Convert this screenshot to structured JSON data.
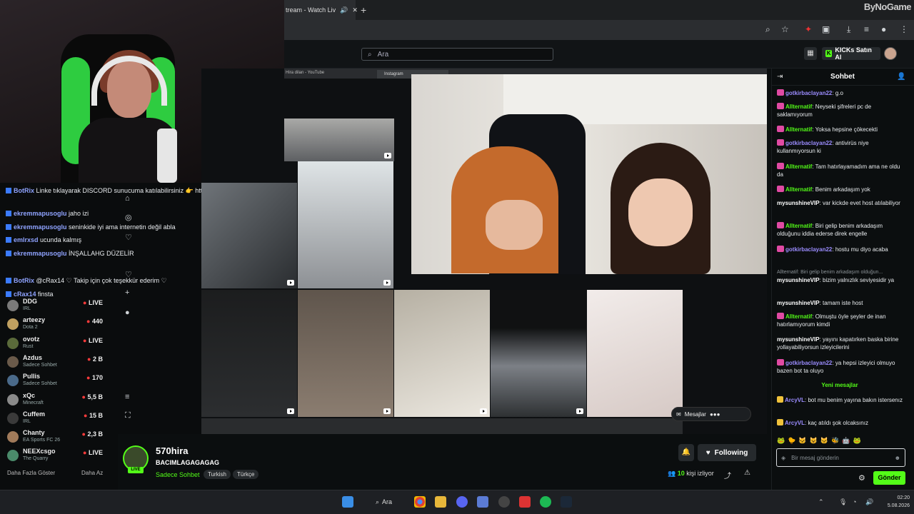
{
  "browser": {
    "tab_title": "tream - Watch Liv",
    "brand": "ByNoGame"
  },
  "site": {
    "search_placeholder": "Ara",
    "kick_button": "KICKs Satın Al"
  },
  "instagram_tabs": {
    "tab1": "Hira dilan - YouTube",
    "tab2": "Instagram"
  },
  "overlay_chat": [
    {
      "user": "BotRix",
      "text": "Linke tıklayarak DISCORD sunucuma katılabilirsiniz 👉 https://discord.gg/HGskgtJUtU"
    },
    {
      "user": "ekremmapusoglu",
      "text": "jaho izi"
    },
    {
      "user": "ekremmapusoglu",
      "text": "seninkide iyi ama internetin değil abla"
    },
    {
      "user": "emlrxsd",
      "text": "ucunda kalmış"
    },
    {
      "user": "ekremmapusoglu",
      "text": "İNŞALLAHG DÜZELİR"
    },
    {
      "user": "BotRix",
      "text": "@cRax14 ♡ Takip için çok teşekkür ederim ♡"
    },
    {
      "user": "cRax14",
      "text": "finsta"
    }
  ],
  "sidebar": {
    "items": [
      {
        "name": "DDG",
        "category": "IRL",
        "viewers": "LIVE"
      },
      {
        "name": "arteezy",
        "category": "Dota 2",
        "viewers": "440"
      },
      {
        "name": "ovotz",
        "category": "Rust",
        "viewers": "LIVE"
      },
      {
        "name": "Azdus",
        "category": "Sadece Sohbet",
        "viewers": "2 B"
      },
      {
        "name": "Pullis",
        "category": "Sadece Sohbet",
        "viewers": "170"
      },
      {
        "name": "xQc",
        "category": "Minecraft",
        "viewers": "5,5 B"
      },
      {
        "name": "Cuffem",
        "category": "IRL",
        "viewers": "15 B"
      },
      {
        "name": "Chanty",
        "category": "EA Sports FC 26",
        "viewers": "2,3 B"
      },
      {
        "name": "NEEXcsgo",
        "category": "The Quarry",
        "viewers": "LIVE"
      }
    ],
    "show_more": "Daha Fazla Göster",
    "show_less": "Daha Az"
  },
  "video": {
    "messages_label": "Mesajlar"
  },
  "stream": {
    "channel": "570hira",
    "title": "BACIMLAGAGAGAG",
    "category": "Sadece Sohbet",
    "tags": [
      "Turkish",
      "Türkçe"
    ],
    "live": "LIVE",
    "viewers_count": "10",
    "viewers_label": "kişi izliyor",
    "follow_label": "Following"
  },
  "chat": {
    "title": "Sohbet",
    "messages": [
      {
        "user": "gotkirbaclayan22",
        "color": "#9b8cff",
        "text": "g.o",
        "badge": "sub"
      },
      {
        "user": "Allternatif",
        "color": "#53fc18",
        "text": "Neyseki şifreleri pc de saklamıyorum",
        "badge": "sub"
      },
      {
        "user": "Allternatif",
        "color": "#53fc18",
        "text": "Yoksa hepsine çökecekti",
        "badge": "sub"
      },
      {
        "user": "gotkirbaclayan22",
        "color": "#9b8cff",
        "text": "antivirüs niye kullanmıyorsun ki",
        "badge": "sub"
      },
      {
        "user": "Allternatif",
        "color": "#53fc18",
        "text": "Tam hatırlayamadım ama ne oldu da",
        "badge": "sub"
      },
      {
        "user": "Allternatif",
        "color": "#53fc18",
        "text": "Benim arkadaşım yok",
        "badge": "sub"
      },
      {
        "user": "mysunshineVIP",
        "color": "#ffffff",
        "text": "var kickde evet host atılabiliyor",
        "badge": ""
      },
      {
        "user": "Allternatif",
        "color": "#53fc18",
        "text": "Biri gelip benim arkadaşım olduğunu iddia ederse direk engelle",
        "badge": "sub"
      },
      {
        "user": "gotkirbaclayan22",
        "color": "#9b8cff",
        "text": "hostu mu diyo acaba",
        "badge": "sub"
      }
    ],
    "reply_preview": "Allternatif: Biri gelip benim arkadaşım olduğun...",
    "messages2": [
      {
        "user": "mysunshineVIP",
        "color": "#ffffff",
        "text": "bizim yalnızlık seviyesidir ya",
        "badge": ""
      },
      {
        "user": "mysunshineVIP",
        "color": "#ffffff",
        "text": "tamam iste host",
        "badge": ""
      },
      {
        "user": "Allternatif",
        "color": "#53fc18",
        "text": "Olmuştu öyle şeyler de inan hatırlamıyorum kimdi",
        "badge": "sub"
      },
      {
        "user": "mysunshineVIP",
        "color": "#ffffff",
        "text": "yayını kapatırken baska birine yollayabiliyorsun izleyicilerini",
        "badge": ""
      },
      {
        "user": "gotkirbaclayan22",
        "color": "#9b8cff",
        "text": "ya hepsi izleyici olmuyo bazen bot ta oluyo",
        "badge": "sub"
      }
    ],
    "new_messages_label": "Yeni mesajlar",
    "messages3": [
      {
        "user": "ArcyVL",
        "color": "#9b8cff",
        "text": "bot mu benim yayına bakın istersenız",
        "badge": "gold"
      },
      {
        "user": "ArcyVL",
        "color": "#9b8cff",
        "text": "kaç atıldı şok olcaksınız",
        "badge": "gold"
      }
    ],
    "input_placeholder": "Bir mesaj gönderin",
    "send_label": "Gönder"
  },
  "taskbar": {
    "search_label": "Ara",
    "time": "02:20",
    "date": "5.08.2026"
  },
  "colors": {
    "kick_green": "#53fc18",
    "background": "#0b0e0f"
  }
}
